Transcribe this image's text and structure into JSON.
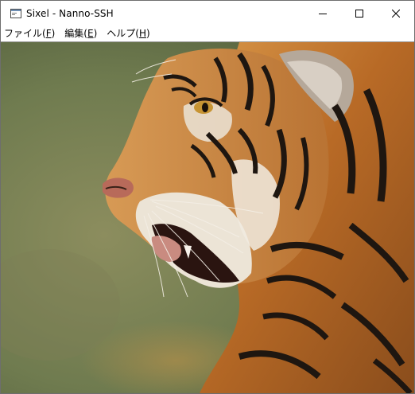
{
  "window": {
    "title": "Sixel - Nanno-SSH",
    "app_icon": "terminal-window-icon",
    "controls": {
      "minimize": "minimize-icon",
      "maximize": "maximize-icon",
      "close": "close-icon"
    }
  },
  "menubar": {
    "items": [
      {
        "label": "ファイル(",
        "accel": "F",
        "suffix": ")"
      },
      {
        "label": "編集(",
        "accel": "E",
        "suffix": ")"
      },
      {
        "label": "ヘルプ(",
        "accel": "H",
        "suffix": ")"
      }
    ]
  },
  "content": {
    "image_subject": "tiger-profile-photo",
    "colors": {
      "background_green": "#7d8553",
      "fur_orange": "#c2782f",
      "stripe_black": "#1e1610",
      "white_fur": "#ece4d6"
    }
  }
}
